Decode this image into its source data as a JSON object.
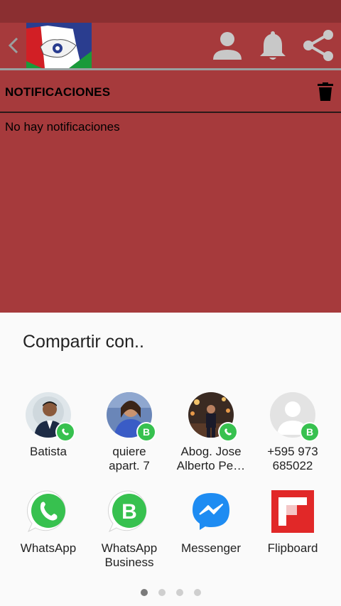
{
  "colors": {
    "primary": "#a63a3c",
    "status_bar": "#8b2f31",
    "sheet_bg": "#fafafa",
    "whatsapp_green": "#37c14f",
    "messenger_blue": "#1e8cf2",
    "flipboard_red": "#e12828"
  },
  "header": {
    "back_icon": "chevron-left-icon",
    "actions": [
      {
        "icon": "user-icon"
      },
      {
        "icon": "bell-icon"
      },
      {
        "icon": "share-icon"
      }
    ]
  },
  "notifications": {
    "title": "NOTIFICACIONES",
    "delete_icon": "trash-icon",
    "empty_message": "No hay notificaciones"
  },
  "share": {
    "title": "Compartir con..",
    "contacts": [
      {
        "label_line1": "Batista",
        "label_line2": "",
        "badge": "whatsapp"
      },
      {
        "label_line1": "quiere",
        "label_line2": "apart. 7",
        "badge": "B"
      },
      {
        "label_line1": "Abog. Jose",
        "label_line2": "Alberto Pe…",
        "badge": "whatsapp"
      },
      {
        "label_line1": "+595 973",
        "label_line2": "685022",
        "badge": "B"
      }
    ],
    "apps": [
      {
        "label_line1": "WhatsApp",
        "label_line2": "",
        "icon": "whatsapp-icon"
      },
      {
        "label_line1": "WhatsApp",
        "label_line2": "Business",
        "icon": "whatsapp-business-icon"
      },
      {
        "label_line1": "Messenger",
        "label_line2": "",
        "icon": "messenger-icon"
      },
      {
        "label_line1": "Flipboard",
        "label_line2": "",
        "icon": "flipboard-icon"
      }
    ],
    "pages": {
      "total": 4,
      "current": 1
    }
  }
}
